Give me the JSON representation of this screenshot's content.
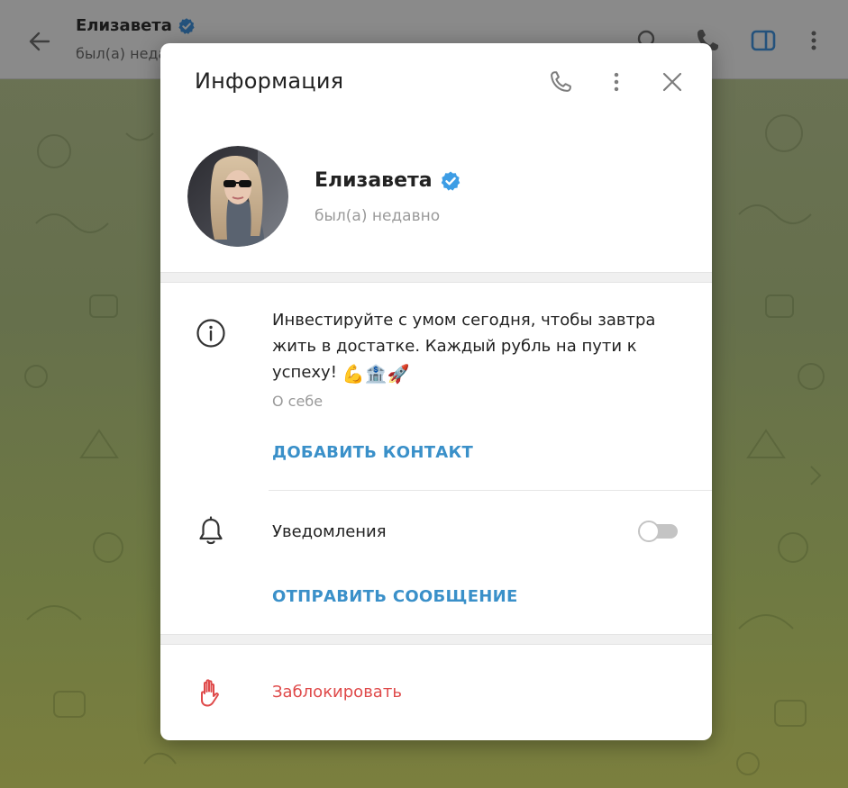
{
  "chat_header": {
    "name": "Елизавета",
    "status": "был(а) недавно"
  },
  "modal": {
    "title": "Информация",
    "profile": {
      "name": "Елизавета",
      "status": "был(а) недавно"
    },
    "bio": {
      "text": "Инвестируйте с умом сегодня, чтобы завтра жить в достатке. Каждый рубль на пути к успеху!",
      "emojis": "💪🏦🚀",
      "label": "О себе"
    },
    "add_contact_label": "ДОБАВИТЬ КОНТАКТ",
    "notifications": {
      "label": "Уведомления",
      "enabled": false
    },
    "send_message_label": "ОТПРАВИТЬ СООБЩЕНИЕ",
    "block_label": "Заблокировать"
  },
  "colors": {
    "accent": "#3a90c9",
    "verified": "#3d9de5",
    "danger": "#df4a4a",
    "secondary_text": "#9a9a9a"
  },
  "icons": {
    "back": "arrow-left-icon",
    "search": "search-icon",
    "call": "phone-icon",
    "sidebar": "sidebar-toggle-icon",
    "more": "more-vertical-icon",
    "close": "close-icon",
    "info": "info-icon",
    "bell": "bell-icon",
    "block": "hand-stop-icon",
    "verified": "verified-badge-icon"
  }
}
